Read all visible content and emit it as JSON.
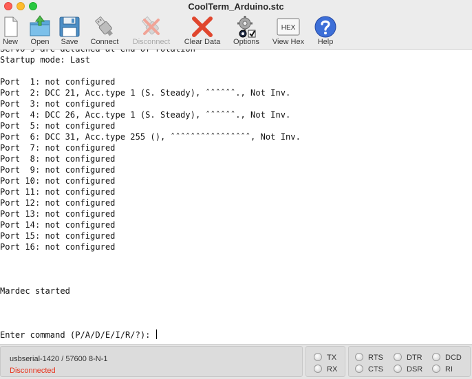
{
  "window": {
    "title": "CoolTerm_Arduino.stc"
  },
  "toolbar": {
    "new_label": "New",
    "open_label": "Open",
    "save_label": "Save",
    "connect_label": "Connect",
    "disconnect_label": "Disconnect",
    "clear_label": "Clear Data",
    "options_label": "Options",
    "viewhex_label": "View Hex",
    "viewhex_icon_text": "HEX",
    "help_label": "Help"
  },
  "terminal": {
    "lines": [
      "Servo's are detached at end of rotation",
      "Startup mode: Last",
      "",
      "Port  1: not configured",
      "Port  2: DCC 21, Acc.type 1 (S. Steady), ˆˆˆˆˆˆ., Not Inv.",
      "Port  3: not configured",
      "Port  4: DCC 26, Acc.type 1 (S. Steady), ˆˆˆˆˆˆ., Not Inv.",
      "Port  5: not configured",
      "Port  6: DCC 31, Acc.type 255 (), ˆˆˆˆˆˆˆˆˆˆˆˆˆˆˆˆ, Not Inv.",
      "Port  7: not configured",
      "Port  8: not configured",
      "Port  9: not configured",
      "Port 10: not configured",
      "Port 11: not configured",
      "Port 12: not configured",
      "Port 13: not configured",
      "Port 14: not configured",
      "Port 15: not configured",
      "Port 16: not configured",
      "",
      "",
      "",
      "Mardec started",
      "",
      "",
      "",
      "Enter command (P/A/D/E/I/R/?): "
    ]
  },
  "status": {
    "connection_info": "usbserial-1420 / 57600 8-N-1",
    "connection_state": "Disconnected",
    "tx_label": "TX",
    "rx_label": "RX",
    "rts_label": "RTS",
    "cts_label": "CTS",
    "dtr_label": "DTR",
    "dsr_label": "DSR",
    "dcd_label": "DCD",
    "ri_label": "RI"
  },
  "colors": {
    "disconnected": "#e8321b",
    "clear_icon": "#e0462e",
    "help_icon": "#3d6fd8"
  }
}
